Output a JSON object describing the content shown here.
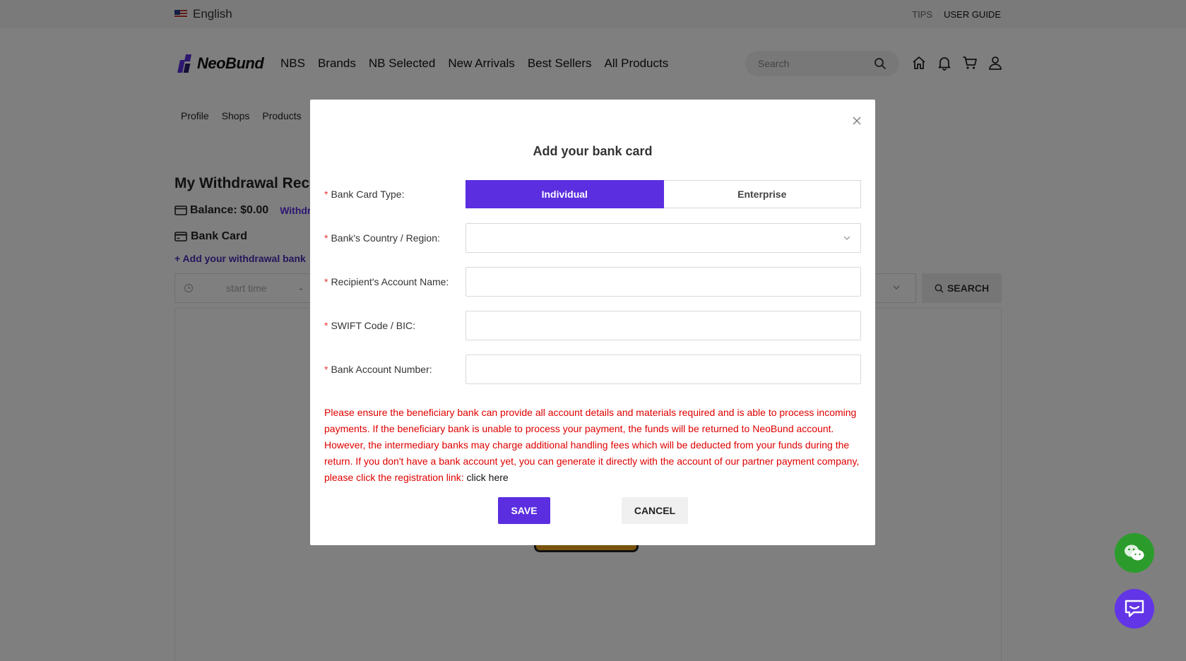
{
  "topbar": {
    "language": "English",
    "links": [
      "TIPS",
      "USER GUIDE"
    ]
  },
  "header": {
    "logo_text": "NeoBund",
    "nav": [
      "NBS",
      "Brands",
      "NB Selected",
      "New Arrivals",
      "Best Sellers",
      "All Products"
    ],
    "search_placeholder": "Search"
  },
  "subnav": [
    "Profile",
    "Shops",
    "Products"
  ],
  "page": {
    "title": "My Withdrawal Rec",
    "balance": "Balance: $0.00",
    "withdraw_link": "Withdr",
    "bank_card_label": "Bank Card",
    "add_bank_link": "+ Add your withdrawal bank",
    "start_time_placeholder": "start time",
    "range_separator": "-",
    "search_button": "SEARCH"
  },
  "modal": {
    "title": "Add your bank card",
    "fields": {
      "card_type_label": "Bank Card Type:",
      "country_label": "Bank's Country / Region:",
      "account_name_label": "Recipient's Account Name:",
      "swift_label": "SWIFT Code / BIC:",
      "account_number_label": "Bank Account Number:"
    },
    "card_type_options": [
      "Individual",
      "Enterprise"
    ],
    "selected_card_type": "Individual",
    "values": {
      "country": "",
      "account_name": "",
      "swift": "",
      "account_number": ""
    },
    "notice": "Please ensure the beneficiary bank can provide all account details and materials required and is able to process incoming payments. If the beneficiary bank is unable to process your payment, the funds will be returned to NeoBund account. However, the intermediary banks may charge additional handling fees which will be deducted from your funds during the return. If you don't have a bank account yet, you can generate it directly with the account of our partner payment company, please click the registration link: ",
    "notice_link": "click here",
    "save_button": "SAVE",
    "cancel_button": "CANCEL"
  },
  "colors": {
    "brand": "#5b2ee0",
    "required": "#e53935",
    "notice": "#e00000",
    "wechat": "#2b9c2b"
  }
}
